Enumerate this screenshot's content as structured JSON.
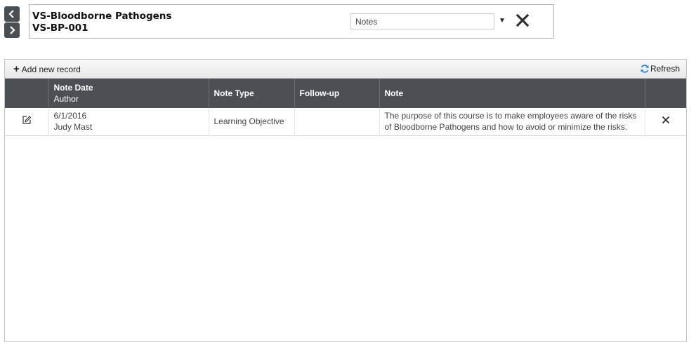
{
  "header": {
    "title_line1": "VS-Bloodborne Pathogens",
    "title_line2": "VS-BP-001",
    "select_value": "Notes"
  },
  "toolbar": {
    "add_label": "Add new record",
    "refresh_label": "Refresh"
  },
  "table": {
    "columns": {
      "note_date": "Note Date",
      "author": "Author",
      "note_type": "Note Type",
      "follow_up": "Follow-up",
      "note": "Note"
    },
    "rows": [
      {
        "note_date": "6/1/2016",
        "author": "Judy Mast",
        "note_type": "Learning Objective",
        "follow_up": "",
        "note": "The purpose of this course is to make employees aware of the risks of Bloodborne Pathogens and how to avoid or minimize the risks."
      }
    ]
  },
  "icons": {
    "prev": "chevron-left-icon",
    "next": "chevron-right-icon",
    "close": "close-icon",
    "add": "plus-icon",
    "refresh": "refresh-icon",
    "edit": "edit-icon",
    "delete": "delete-icon"
  },
  "colors": {
    "header_bar": "#4c5055",
    "nav_button": "#4a4f54",
    "refresh_accent": "#3a8fd6"
  }
}
